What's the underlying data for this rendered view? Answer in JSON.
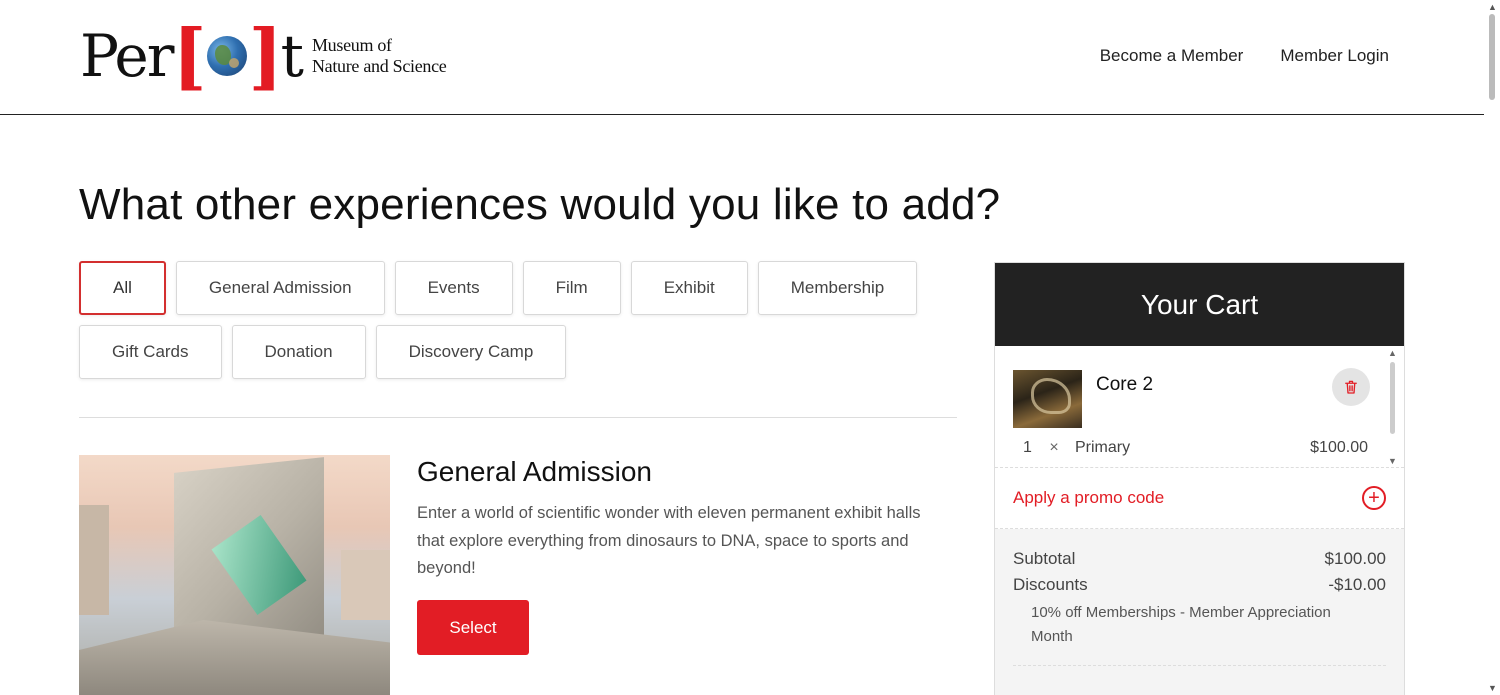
{
  "header": {
    "logo": {
      "word_left": "Per",
      "word_right": "t",
      "tagline_line1": "Museum of",
      "tagline_line2": "Nature and Science"
    },
    "nav": {
      "become_member": "Become a Member",
      "member_login": "Member Login"
    }
  },
  "page": {
    "title": "What other experiences would you like to add?"
  },
  "filters": {
    "row1": [
      "All",
      "General Admission",
      "Events",
      "Film",
      "Exhibit",
      "Membership"
    ],
    "row2": [
      "Gift Cards",
      "Donation",
      "Discovery Camp"
    ],
    "active": "All"
  },
  "product": {
    "name": "General Admission",
    "description": "Enter a world of scientific wonder with eleven permanent exhibit halls that explore everything from dinosaurs to DNA, space to sports and beyond!",
    "select_label": "Select"
  },
  "cart": {
    "title": "Your Cart",
    "items": [
      {
        "name": "Core 2",
        "qty": "1",
        "times": "×",
        "type": "Primary",
        "price": "$100.00"
      }
    ],
    "promo_label": "Apply a promo code",
    "subtotal_label": "Subtotal",
    "subtotal_value": "$100.00",
    "discounts_label": "Discounts",
    "discounts_value": "-$10.00",
    "discount_note": "10% off Memberships - Member Appreciation Month"
  },
  "colors": {
    "accent": "#e21d25",
    "cart_header": "#222222"
  }
}
